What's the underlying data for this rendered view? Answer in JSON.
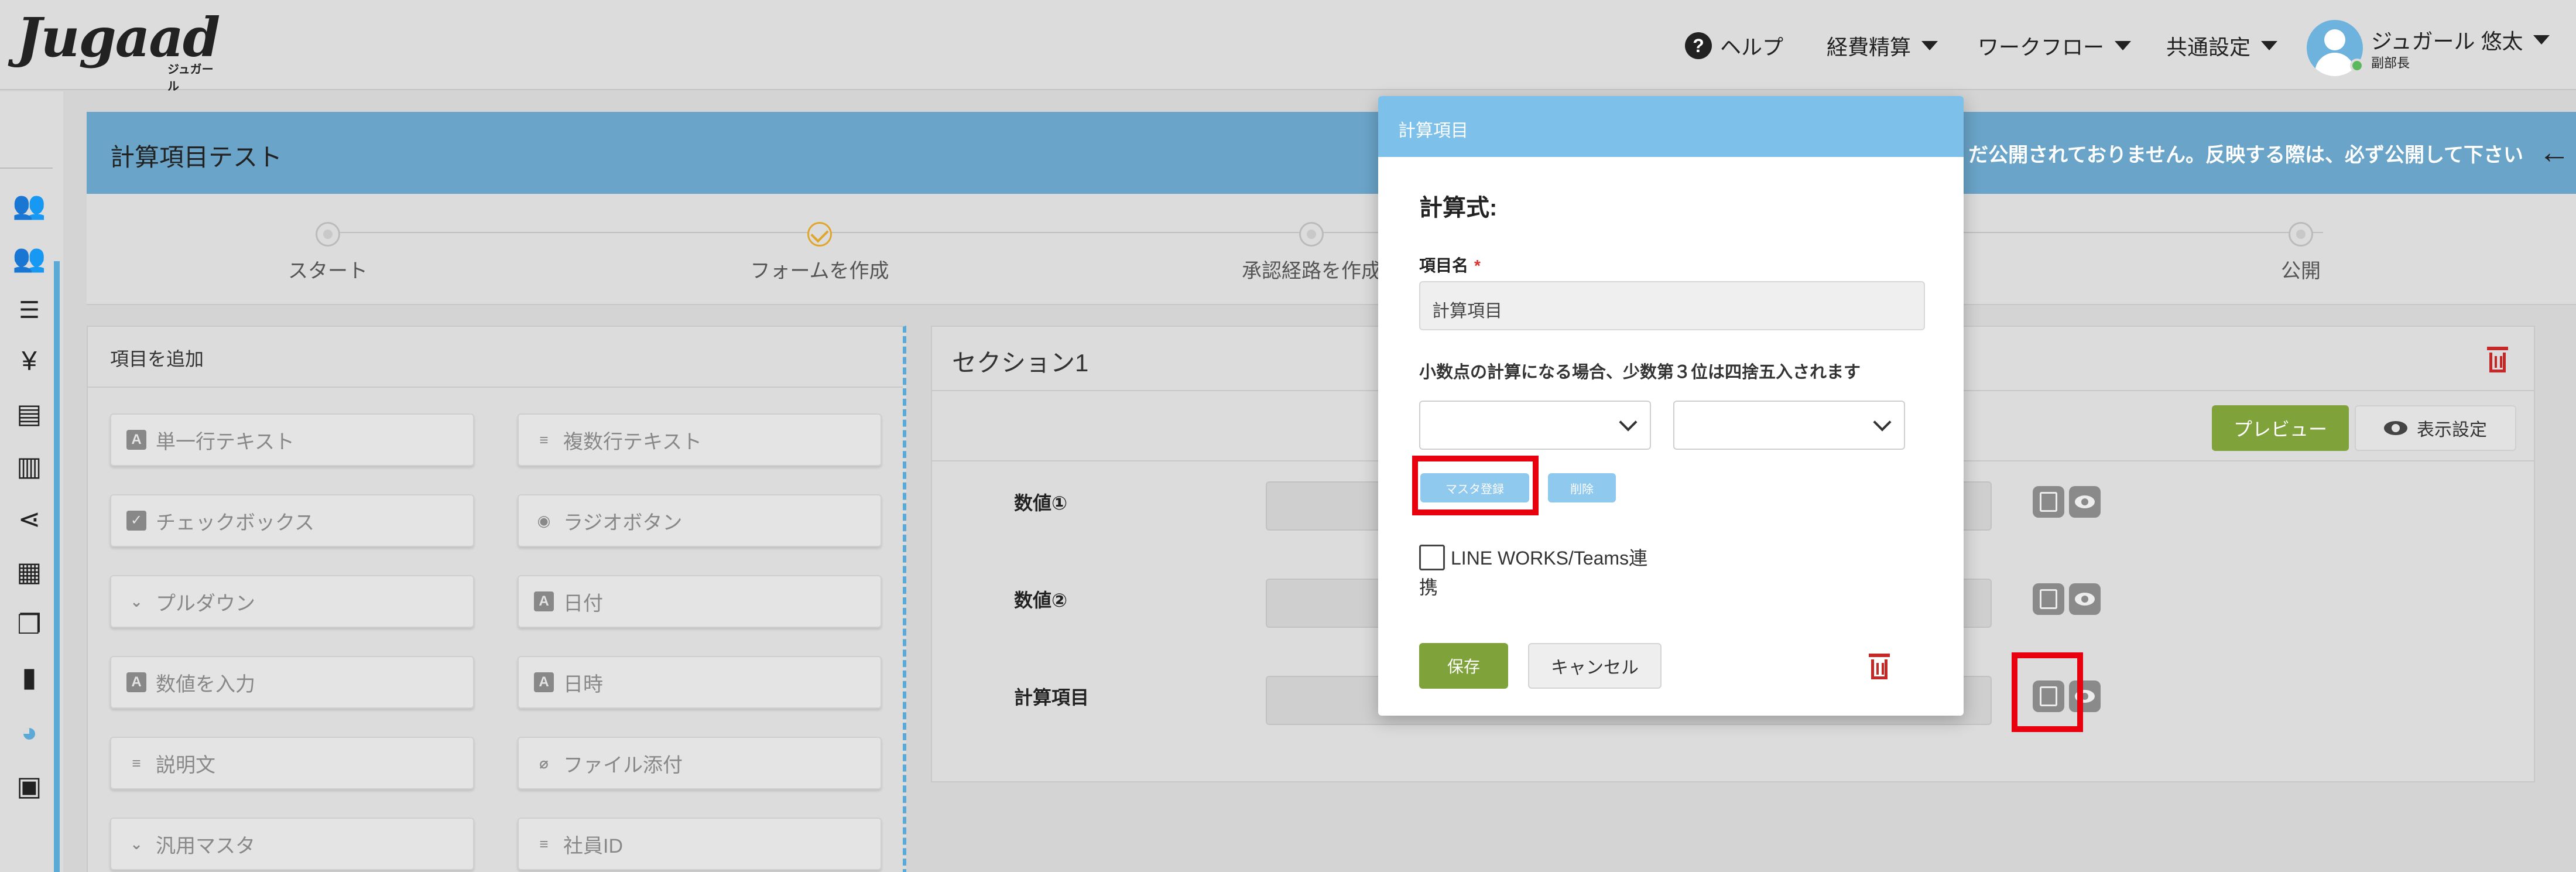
{
  "header": {
    "logo": "Jugaad",
    "logo_sub": "ジュガール",
    "help": "ヘルプ",
    "nav": [
      "経費精算",
      "ワークフロー",
      "共通設定"
    ],
    "user_name": "ジュガール 悠太",
    "user_role": "副部長"
  },
  "sidebar": {
    "icons": [
      "users-icon",
      "team-icon",
      "list-icon",
      "yen-icon",
      "document-icon",
      "book-icon",
      "share-icon",
      "table-icon",
      "copy-icon",
      "file-icon",
      "palette-icon",
      "wallet-icon"
    ]
  },
  "page": {
    "title": "計算項目テスト",
    "notice": "だ公開されておりません。反映する際は、必ず公開して下さい"
  },
  "steps": [
    {
      "label": "スタート",
      "state": "done"
    },
    {
      "label": "フォームを作成",
      "state": "active"
    },
    {
      "label": "承認経路を作成",
      "state": "pending"
    },
    {
      "label": "公開",
      "state": "pending"
    }
  ],
  "palette": {
    "title": "項目を追加",
    "items": [
      {
        "label": "単一行テキスト",
        "icon": "A"
      },
      {
        "label": "複数行テキスト",
        "icon": "≡"
      },
      {
        "label": "チェックボックス",
        "icon": "✓"
      },
      {
        "label": "ラジオボタン",
        "icon": "◉"
      },
      {
        "label": "プルダウン",
        "icon": "⌄"
      },
      {
        "label": "日付",
        "icon": "A"
      },
      {
        "label": "数値を入力",
        "icon": "A"
      },
      {
        "label": "日時",
        "icon": "A"
      },
      {
        "label": "説明文",
        "icon": "≡"
      },
      {
        "label": "ファイル添付",
        "icon": "⌀"
      },
      {
        "label": "汎用マスタ",
        "icon": "⌄"
      },
      {
        "label": "社員ID",
        "icon": "≡"
      }
    ]
  },
  "section": {
    "title": "セクション1",
    "preview": "プレビュー",
    "display_settings": "表示設定",
    "rows": [
      "数値①",
      "数値②",
      "計算項目"
    ]
  },
  "modal": {
    "title": "計算項目",
    "subtitle": "計算式:",
    "field_label": "項目名",
    "required_mark": "*",
    "field_value": "計算項目",
    "note": "小数点の計算になる場合、少数第３位は四捨五入されます",
    "master_btn": "マスタ登録",
    "delete_btn": "削除",
    "checkbox_line1": "LINE WORKS/Teams連",
    "checkbox_line2": "携",
    "save": "保存",
    "cancel": "キャンセル"
  },
  "colors": {
    "accent_blue": "#6aa4c8",
    "modal_header": "#7dc1ea",
    "green": "#7fa23a",
    "highlight_red": "#e8000f",
    "danger": "#c62828"
  }
}
